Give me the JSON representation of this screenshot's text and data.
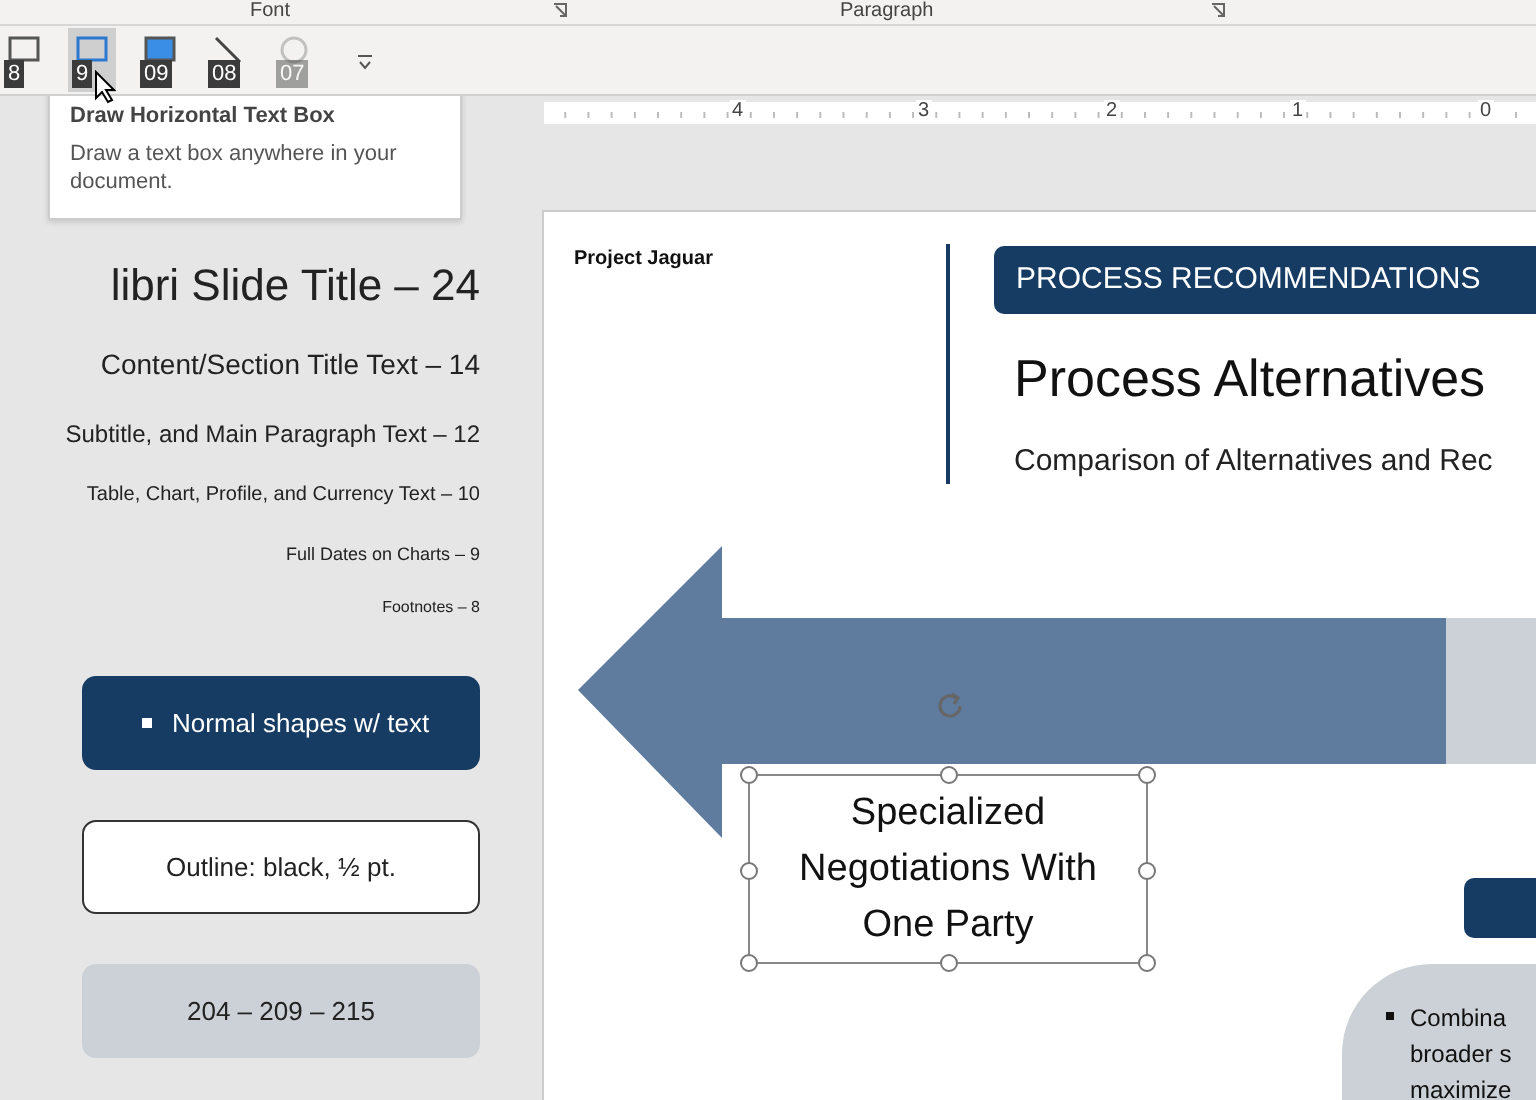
{
  "ribbon": {
    "groups": [
      {
        "label": "Font"
      },
      {
        "label": "Paragraph"
      }
    ]
  },
  "quick_access": [
    {
      "key_tip": "8",
      "selected": false,
      "disabled": false
    },
    {
      "key_tip": "9",
      "selected": true,
      "disabled": false
    },
    {
      "key_tip": "09",
      "selected": false,
      "disabled": false
    },
    {
      "key_tip": "08",
      "selected": false,
      "disabled": false
    },
    {
      "key_tip": "07",
      "selected": false,
      "disabled": true
    }
  ],
  "tooltip": {
    "title": "Draw Horizontal Text Box",
    "description": "Draw a text box anywhere in your document."
  },
  "ruler": {
    "labels": [
      "4",
      "3",
      "2",
      "1",
      "0"
    ]
  },
  "style_guide": {
    "text_samples": [
      {
        "kind": "title",
        "text": "libri Slide Title – 24"
      },
      {
        "kind": "section",
        "text": "Content/Section Title Text – 14"
      },
      {
        "kind": "body",
        "text": "Subtitle, and Main Paragraph Text – 12"
      },
      {
        "kind": "table",
        "text": "Table, Chart, Profile, and Currency Text – 10"
      },
      {
        "kind": "dates",
        "text": "Full Dates on Charts – 9"
      },
      {
        "kind": "footnote",
        "text": "Footnotes – 8"
      }
    ],
    "shapes": [
      {
        "kind": "filled",
        "text": "Normal shapes w/ text"
      },
      {
        "kind": "outline",
        "text": "Outline: black, ½ pt."
      },
      {
        "kind": "gray",
        "text": "204 – 209 – 215"
      }
    ]
  },
  "slide": {
    "header": "Project Jaguar",
    "banner": "PROCESS RECOMMENDATIONS",
    "title": "Process Alternatives",
    "subtitle": "Comparison of Alternatives and Rec",
    "text_box": {
      "text": "Specialized Negotiations With One Party",
      "selected": true
    },
    "bullet_box": {
      "lines": [
        "Combina",
        "broader s",
        "maximize"
      ]
    }
  }
}
